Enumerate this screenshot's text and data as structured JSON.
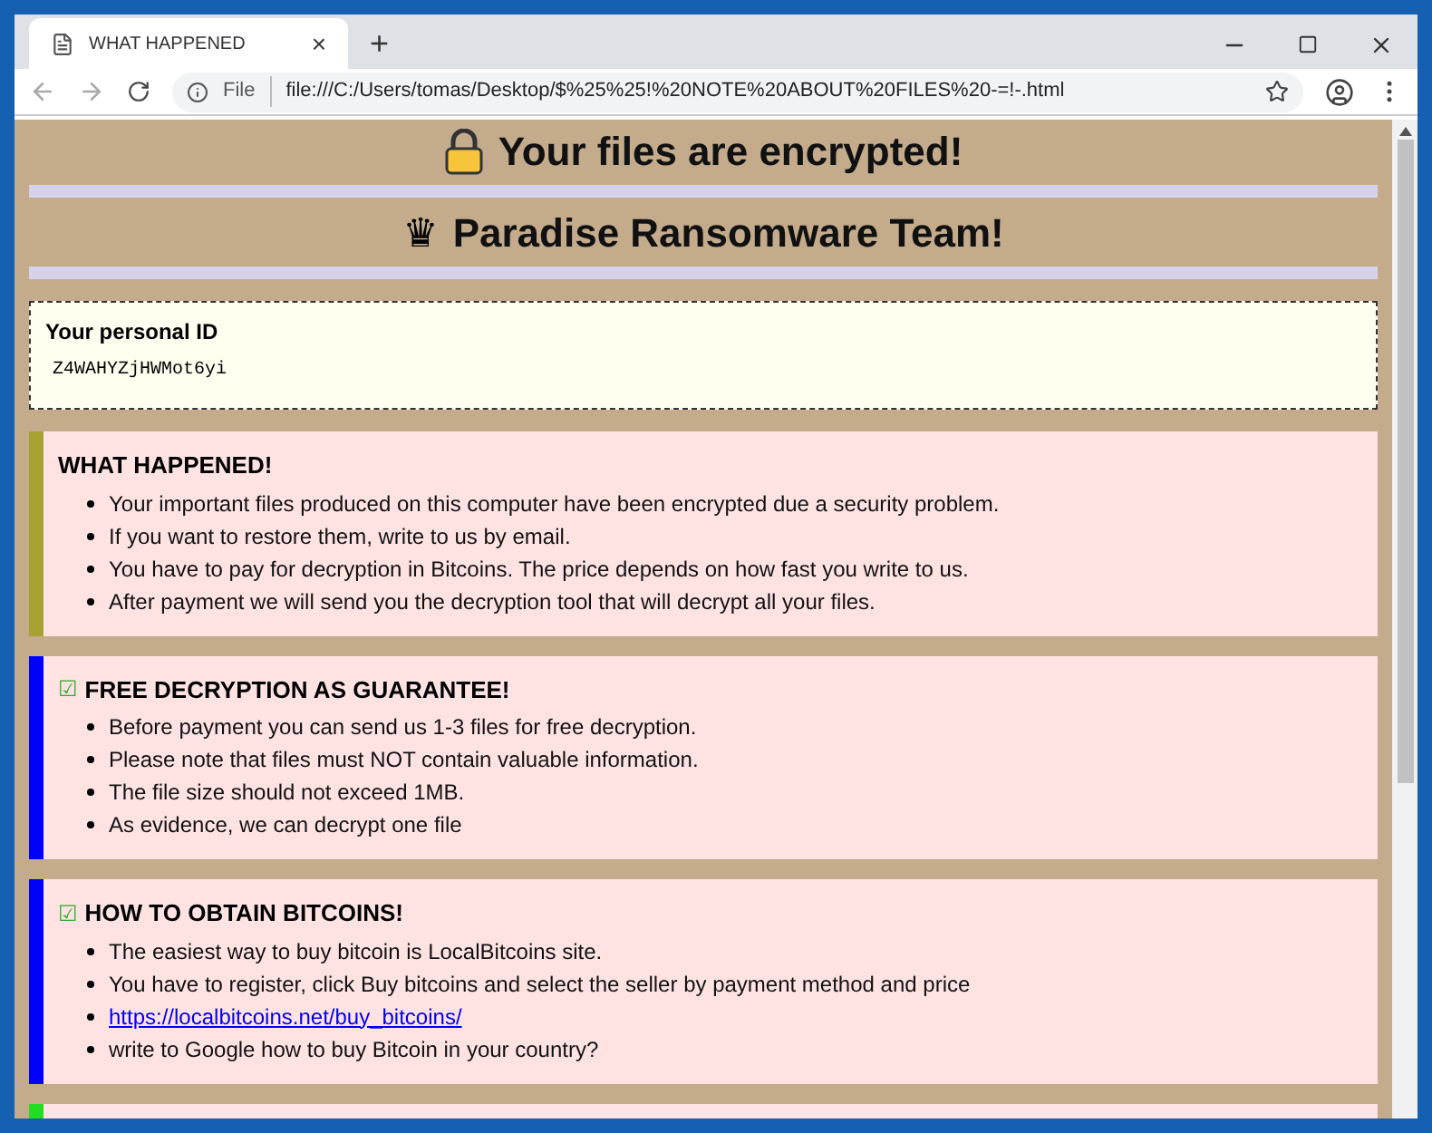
{
  "tab": {
    "title": "WHAT HAPPENED",
    "close": "×",
    "new_tab": "+"
  },
  "address_bar": {
    "scheme_label": "File",
    "url": "file:///C:/Users/tomas/Desktop/$%25%25!%20NOTE%20ABOUT%20FILES%20-=!-.html"
  },
  "headings": [
    {
      "kind": "lock",
      "text": "Your files are encrypted!"
    },
    {
      "kind": "glyph",
      "glyph": "♛",
      "text": "Paradise Ransomware Team!"
    }
  ],
  "personal_id": {
    "label": "Your personal ID",
    "value": "Z4WAHYZjHWMot6yi"
  },
  "sections": [
    {
      "color": "#a8a032",
      "title": "WHAT HAPPENED!",
      "items": [
        {
          "kind": "text",
          "text": "Your important files produced on this computer have been encrypted due a security problem."
        },
        {
          "kind": "text",
          "text": "If you want to restore them, write to us by email."
        },
        {
          "kind": "text",
          "text": "You have to pay for decryption in Bitcoins. The price depends on how fast you write to us."
        },
        {
          "kind": "text",
          "text": "After payment we will send you the decryption tool that will decrypt all your files."
        }
      ]
    },
    {
      "color": "#0000ff",
      "mark": "☑",
      "title": "FREE DECRYPTION AS GUARANTEE!",
      "items": [
        {
          "kind": "text",
          "text": "Before payment you can send us 1-3 files for free decryption."
        },
        {
          "kind": "text",
          "text": "Please note that files must NOT contain valuable information."
        },
        {
          "kind": "text",
          "text": "The file size should not exceed 1MB."
        },
        {
          "kind": "text",
          "text": "As evidence, we can decrypt one file"
        }
      ]
    },
    {
      "color": "#0000ff",
      "mark": "☑",
      "title": "HOW TO OBTAIN BITCOINS!",
      "items": [
        {
          "kind": "text",
          "text": "The easiest way to buy bitcoin is LocalBitcoins site."
        },
        {
          "kind": "text",
          "text": "You have to register, click Buy bitcoins and select the seller by payment method and price"
        },
        {
          "kind": "link",
          "text": "https://localbitcoins.net/buy_bitcoins/"
        },
        {
          "kind": "text",
          "text": "write to Google how to buy Bitcoin in your country?"
        }
      ]
    },
    {
      "color": "#22dd22"
    }
  ]
}
